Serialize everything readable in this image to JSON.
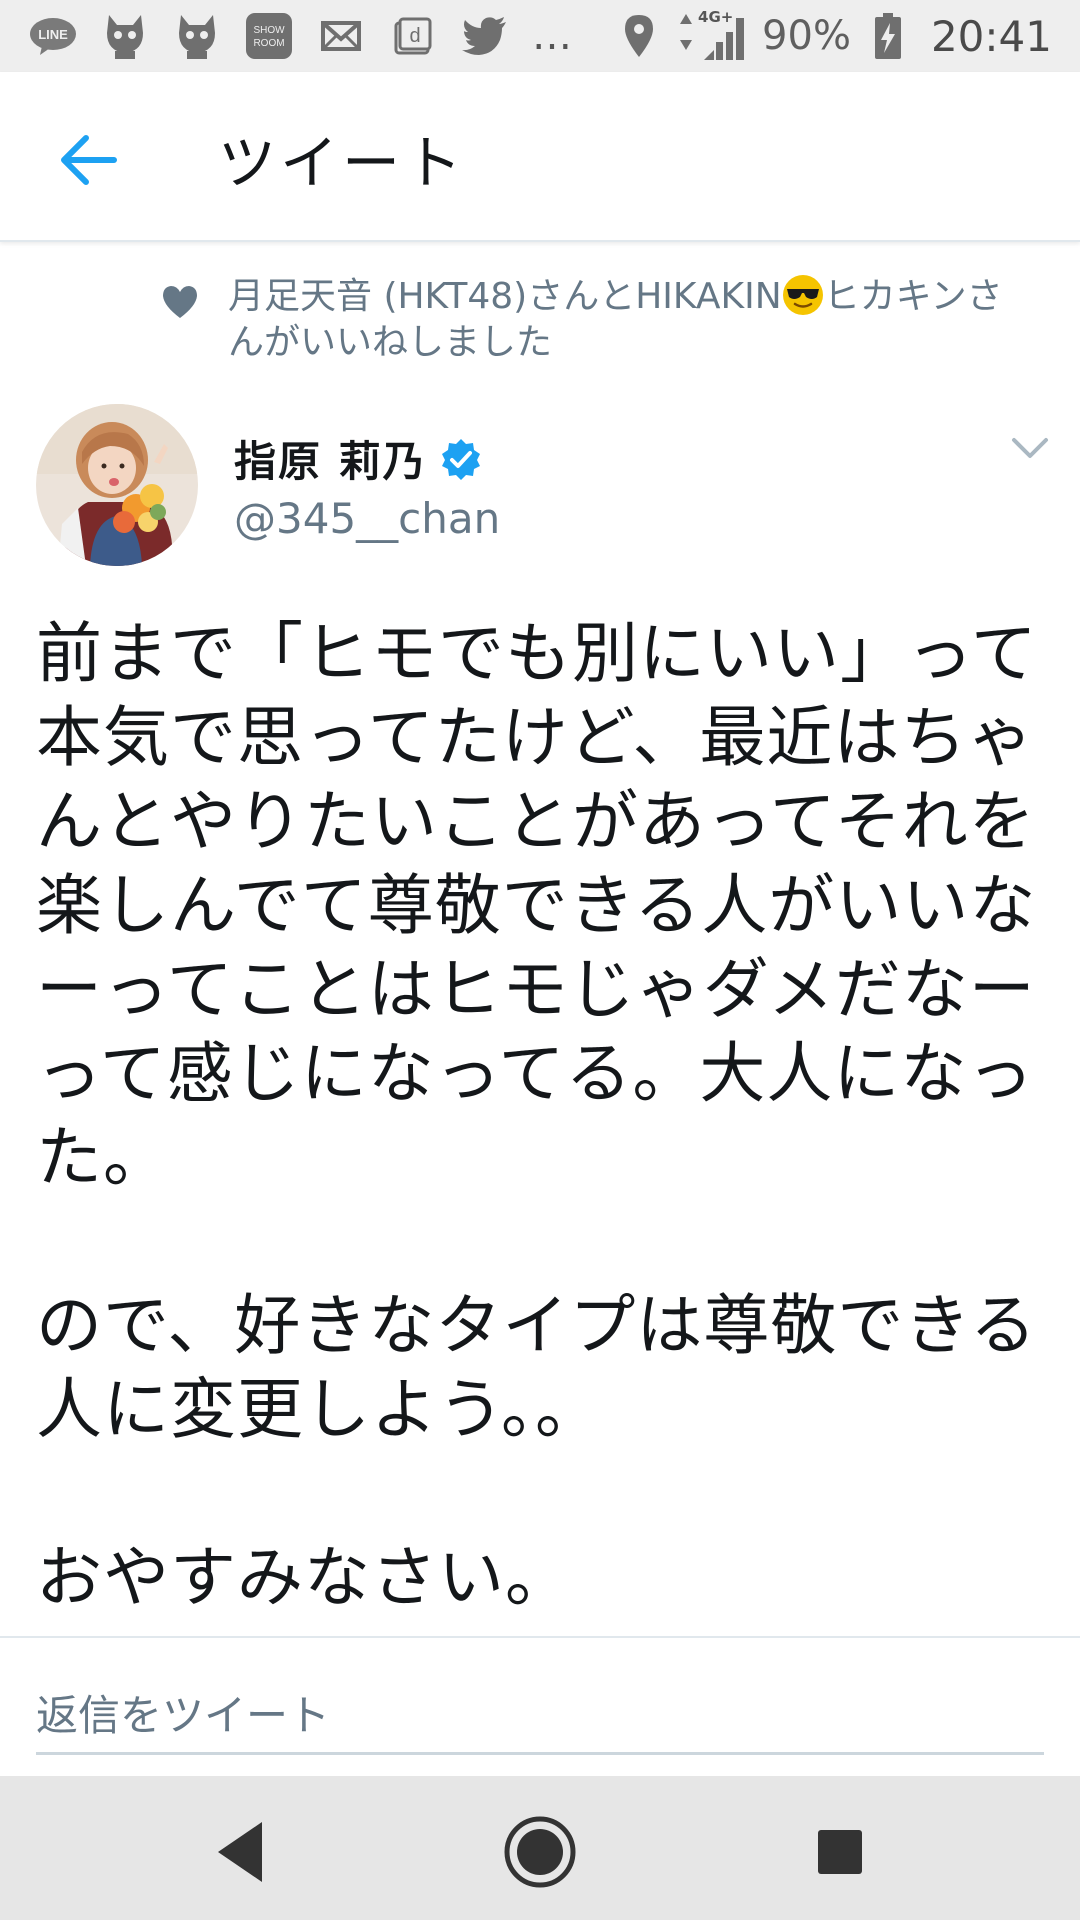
{
  "status_bar": {
    "left_icons": [
      "line-icon",
      "cat-mascot-icon",
      "cat-mascot-icon",
      "showroom-icon",
      "mail-icon",
      "d-app-icon",
      "twitter-bird-icon"
    ],
    "line_label": "LINE",
    "showroom_label": "SHOW ROOM",
    "overflow": "…",
    "network": "4G+",
    "battery": "90%",
    "time": "20:41"
  },
  "header": {
    "title": "ツイート"
  },
  "social_context": {
    "text_before_emoji": "月足天音 (HKT48)さんとHIKAKIN",
    "text_after_emoji": "ヒカキンさんがいいねしました"
  },
  "tweet": {
    "display_name": "指原 莉乃",
    "username": "@345__chan",
    "verified": true,
    "text": "前まで「ヒモでも別にいい」って本気で思ってたけど、最近はちゃんとやりたいことがあってそれを楽しんでて尊敬できる人がいいなーってことはヒモじゃダメだなーって感じになってる。大人になった。\n\nので、好きなタイプは尊敬できる人に変更しよう。。\n\nおやすみなさい。"
  },
  "reply": {
    "placeholder": "返信をツイート"
  },
  "colors": {
    "twitter_blue": "#1da1f2",
    "secondary_text": "#657786",
    "primary_text": "#14171a",
    "divider": "#e1e8ed"
  }
}
